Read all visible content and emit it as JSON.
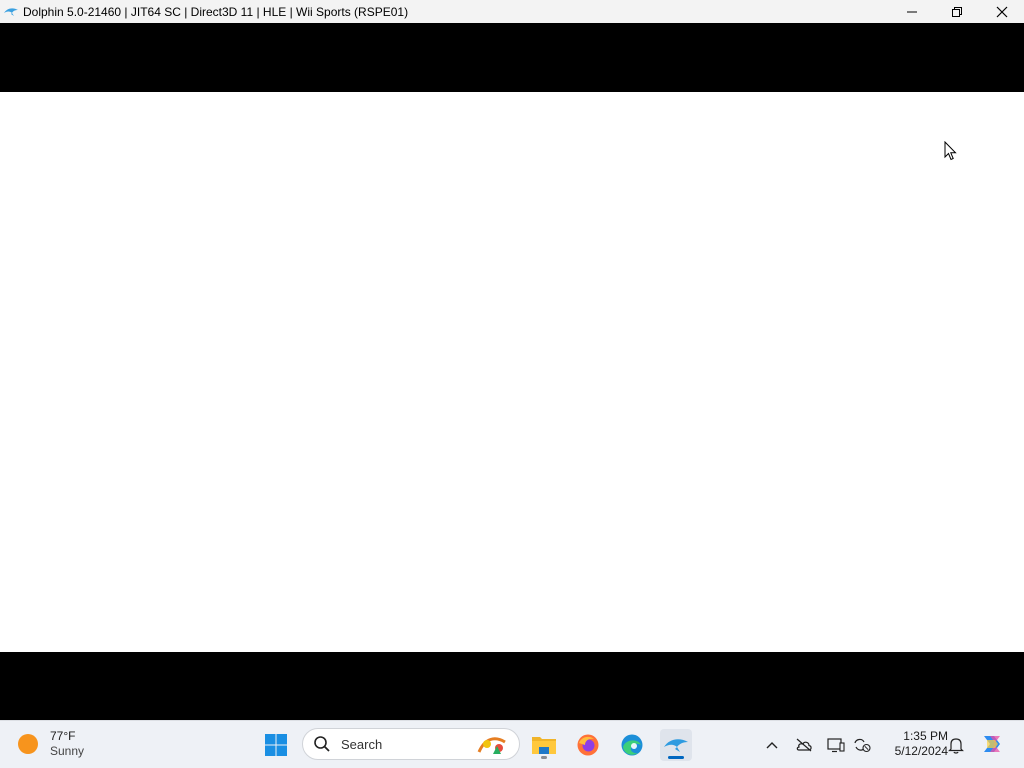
{
  "window": {
    "title": "Dolphin 5.0-21460 | JIT64 SC | Direct3D 11 | HLE | Wii Sports (RSPE01)",
    "controls": [
      "minimize",
      "restore",
      "close"
    ]
  },
  "taskbar": {
    "weather": {
      "temperature": "77°F",
      "condition": "Sunny"
    },
    "search": {
      "label": "Search"
    },
    "pinned": [
      {
        "name": "start",
        "icon": "windows-logo-icon"
      },
      {
        "name": "file-explorer",
        "icon": "folder-icon"
      },
      {
        "name": "firefox",
        "icon": "firefox-icon"
      },
      {
        "name": "edge",
        "icon": "edge-icon"
      },
      {
        "name": "dolphin",
        "icon": "dolphin-icon",
        "active": true
      }
    ],
    "tray": [
      "chevron-up-icon",
      "cloud-off-icon",
      "display-icon",
      "sync-icon",
      "bell-icon",
      "copilot-icon"
    ],
    "clock": {
      "time": "1:35 PM",
      "date": "5/12/2024"
    }
  },
  "colors": {
    "titlebar": "#f3f3f3",
    "letterbox": "#000000",
    "game_frame": "#ffffff",
    "taskbar": "#eef1f6",
    "accent": "#0067c0"
  }
}
